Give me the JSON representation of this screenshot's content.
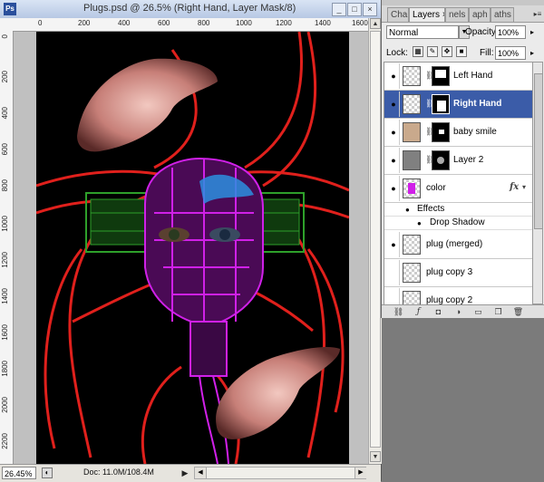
{
  "document": {
    "title": "Plugs.psd @ 26.5% (Right Hand, Layer Mask/8)",
    "ps_badge": "Ps",
    "minimize": "_",
    "maximize": "□",
    "close": "×",
    "ruler_top_labels": [
      "0",
      "200",
      "400",
      "600",
      "800",
      "1000",
      "1200",
      "1400",
      "1600"
    ],
    "ruler_left_labels": [
      "0",
      "200",
      "400",
      "600",
      "800",
      "1000",
      "1200",
      "1400",
      "1600",
      "1800",
      "2000",
      "2200"
    ],
    "zoom": "26.45%",
    "doc_info": "Doc: 11.0M/108.4M",
    "status_arrow": "▶"
  },
  "panel": {
    "tabs": [
      "Char",
      "Layers ×",
      "nels",
      "aph",
      "aths"
    ],
    "menu_icon": "▸≡",
    "blend_mode": "Normal",
    "opacity_label": "Opacity:",
    "opacity_value": "100%",
    "lock_label": "Lock:",
    "fill_label": "Fill:",
    "fill_value": "100%",
    "effects_label": "Effects",
    "drop_shadow_label": "Drop Shadow",
    "fx": "fx",
    "layers": [
      {
        "name": "Left Hand",
        "visible": true,
        "selected": false
      },
      {
        "name": "Right Hand",
        "visible": true,
        "selected": true
      },
      {
        "name": "baby smile",
        "visible": true,
        "selected": false
      },
      {
        "name": "Layer 2",
        "visible": true,
        "selected": false
      },
      {
        "name": "color",
        "visible": true,
        "selected": false
      },
      {
        "name": "plug (merged)",
        "visible": true,
        "selected": false
      },
      {
        "name": "plug copy 3",
        "visible": false,
        "selected": false
      },
      {
        "name": "plug copy 2",
        "visible": false,
        "selected": false
      }
    ]
  },
  "colors": {
    "selection": "#3b5ca8",
    "wire_red": "#e0201c",
    "wire_magenta": "#d020e8",
    "wire_green": "#2ea02a",
    "accent_blue": "#2b8fe0"
  },
  "icons": {
    "eye": "eye-icon",
    "link": "chain-link-icon",
    "lock_transparency": "lock-transparent-pixels-icon",
    "lock_paint": "lock-image-pixels-icon",
    "lock_move": "lock-position-icon",
    "lock_all": "lock-all-icon"
  }
}
